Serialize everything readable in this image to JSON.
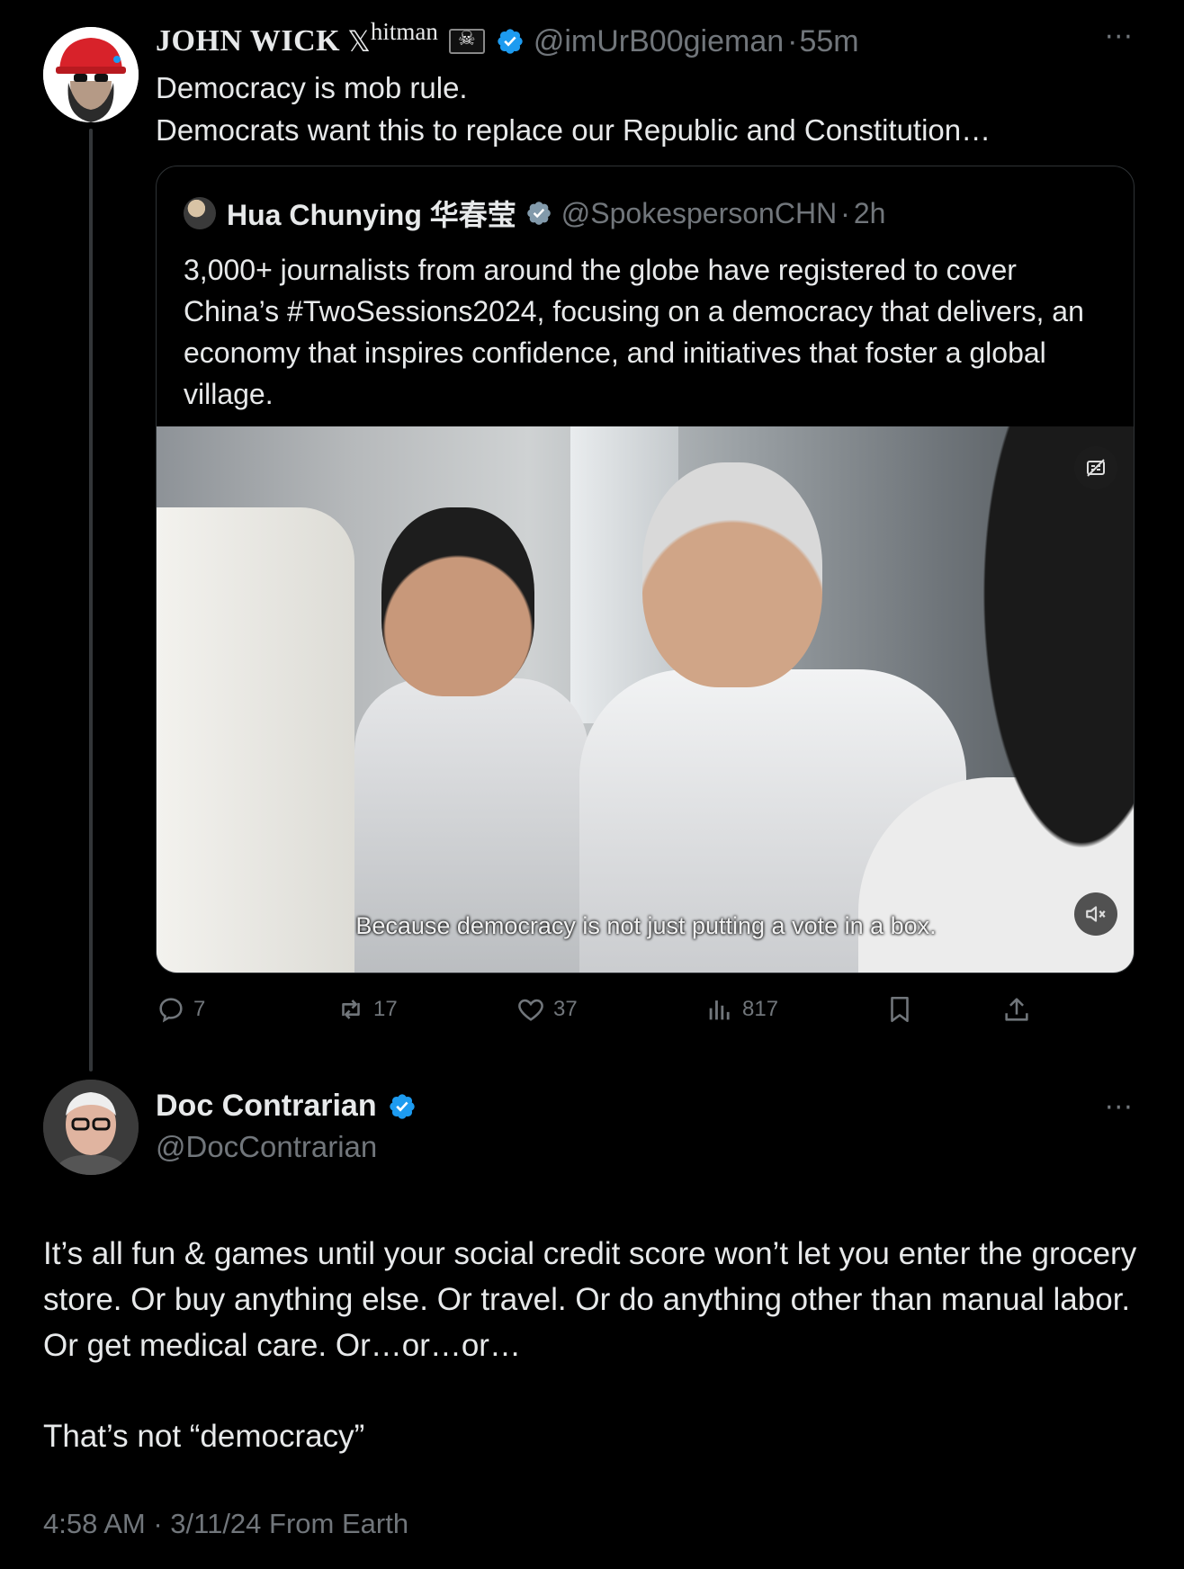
{
  "tweet1": {
    "display_name": "JOHN WICK",
    "x_glyph": "𝕏",
    "superscript": "hitman",
    "handle": "@imUrB00gieman",
    "separator": "·",
    "time": "55m",
    "text_line1": "Democracy is mob rule.",
    "text_line2": "Democrats want this to replace our Republic and Constitution…",
    "more_label": "···"
  },
  "quote": {
    "display_name": "Hua Chunying ",
    "display_name_cjk": "华春莹",
    "handle": "@SpokespersonCHN",
    "separator": "·",
    "time": "2h",
    "text": "3,000+ journalists from around the globe have registered to cover China’s #TwoSessions2024, focusing on a democracy that delivers, an economy that inspires confidence, and initiatives that foster a global village.",
    "video_caption": "Because democracy is not just putting a vote in a box."
  },
  "actions": {
    "replies": "7",
    "reposts": "17",
    "likes": "37",
    "views": "817"
  },
  "tweet2": {
    "display_name": "Doc Contrarian",
    "handle": "@DocContrarian",
    "text": "It’s all fun & games until your social credit score won’t let you enter the grocery store. Or buy anything else. Or travel. Or do anything other than manual labor. Or get medical care. Or…or…or…",
    "text2": "That’s not “democracy”",
    "timestamp": "4:58 AM · 3/11/24 From Earth",
    "more_label": "···"
  },
  "colors": {
    "background": "#000000",
    "text": "#e7e9ea",
    "muted": "#71767b",
    "verified": "#1d9bf0",
    "border": "#2f3336"
  },
  "icons": {
    "verified": "verified-badge-icon",
    "reply": "reply-icon",
    "repost": "repost-icon",
    "like": "heart-icon",
    "views": "views-icon",
    "bookmark": "bookmark-icon",
    "share": "share-icon",
    "captions": "captions-icon",
    "mute": "muted-speaker-icon"
  }
}
